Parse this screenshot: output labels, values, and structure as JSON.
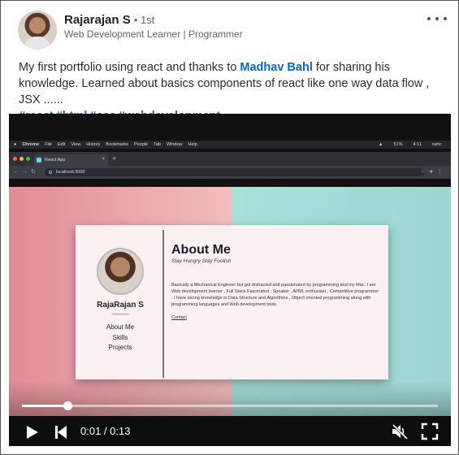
{
  "post": {
    "author": {
      "name": "Rajarajan S",
      "connection": "• 1st",
      "headline": "Web Development Learner | Programmer"
    },
    "text_before_mention": "My first portfolio using react and thanks to ",
    "mention": "Madhav Bahl",
    "text_after_mention": " for sharing his knowledge. Learned about basics components of react like one way data flow , JSX ......",
    "hashtags": [
      "#react",
      "#html",
      "#css",
      "#webdevelopment"
    ]
  },
  "video": {
    "mac_menu": [
      "Chrome",
      "File",
      "Edit",
      "View",
      "History",
      "Bookmarks",
      "People",
      "Tab",
      "Window",
      "Help"
    ],
    "mac_status": [
      "51%",
      "4:11",
      "ramc"
    ],
    "browser_tab_title": "React App",
    "url": "localhost:3000",
    "portfolio": {
      "name": "RajaRajan S",
      "nav": [
        "About Me",
        "Skills",
        "Projects"
      ],
      "about_title": "About Me",
      "about_subtitle": "Stay Hungry Stay Foolish",
      "about_body": "Basically a Mechanical Engineer but got distracted and passionated by programming and my Mac. I am Web development learner , Full Stack Fascinated , Speaker , AI/ML enthusiast , Competitive programmer . I have strong knowledge in Data Structure and Algorithms , Object oriented programming along with programming languages and Web development tools.",
      "contact": "Contact"
    },
    "player": {
      "current_time": "0:01",
      "duration": "0:13",
      "time_text": "0:01 / 0:13",
      "progress_fraction": 0.11,
      "muted": true
    }
  }
}
